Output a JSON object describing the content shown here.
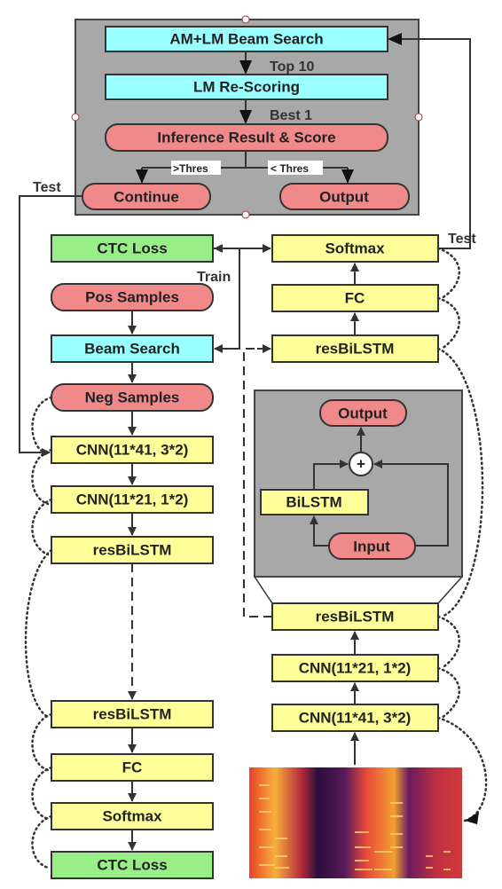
{
  "inference_panel": {
    "am_lm_beam_search": "AM+LM Beam Search",
    "top10": "Top 10",
    "lm_rescoring": "LM Re-Scoring",
    "best1": "Best 1",
    "inference_result": "Inference Result & Score",
    "gt_thres": ">Thres",
    "lt_thres": "< Thres",
    "continue": "Continue",
    "output": "Output"
  },
  "labels": {
    "test_left": "Test",
    "train": "Train",
    "test_right": "Test"
  },
  "left_column": [
    "CTC Loss",
    "Pos Samples",
    "Beam Search",
    "Neg Samples",
    "CNN(11*41, 3*2)",
    "CNN(11*21, 1*2)",
    "resBiLSTM",
    "resBiLSTM",
    "FC",
    "Softmax",
    "CTC Loss"
  ],
  "right_column": [
    "Softmax",
    "FC",
    "resBiLSTM",
    "resBiLSTM",
    "CNN(11*21, 1*2)",
    "CNN(11*41, 3*2)"
  ],
  "res_block": {
    "output": "Output",
    "plus": "+",
    "bilstm": "BiLSTM",
    "input": "Input"
  },
  "colors": {
    "cyan": "#99ffff",
    "pink": "#f08a8a",
    "yellow": "#ffff99",
    "green": "#99ee88",
    "panel": "#a8a8a8"
  }
}
